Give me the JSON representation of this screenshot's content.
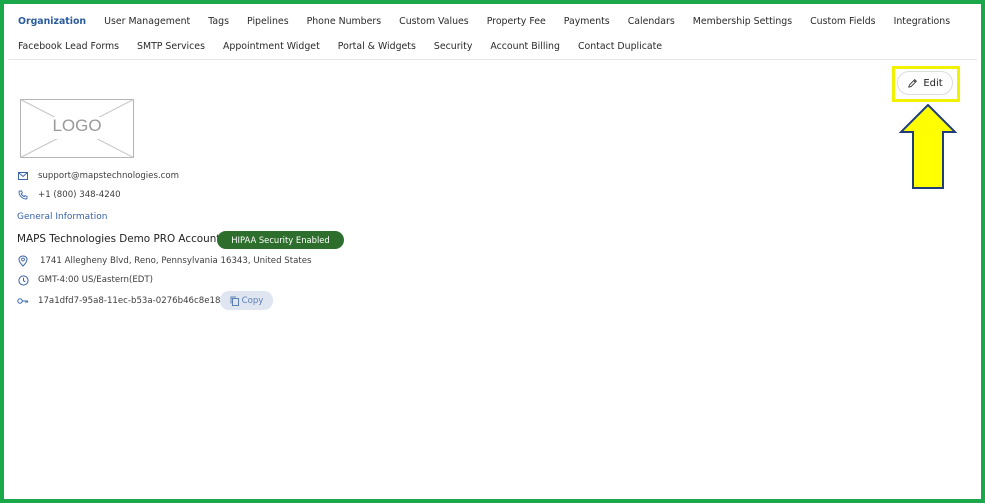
{
  "nav": {
    "row1": [
      "Organization",
      "User Management",
      "Tags",
      "Pipelines",
      "Phone Numbers",
      "Custom Values",
      "Property Fee",
      "Payments",
      "Calendars",
      "Membership Settings",
      "Custom Fields",
      "Integrations"
    ],
    "row2": [
      "Facebook Lead Forms",
      "SMTP Services",
      "Appointment Widget",
      "Portal & Widgets",
      "Security",
      "Account Billing",
      "Contact Duplicate"
    ],
    "active": "Organization"
  },
  "edit": {
    "label": "Edit",
    "icon": "pencil-icon"
  },
  "logo": {
    "text": "LOGO"
  },
  "contact": {
    "email": "support@mapstechnologies.com",
    "phone": "+1 (800) 348-4240"
  },
  "general": {
    "title": "General Information",
    "account_name": "MAPS Technologies Demo PRO Account",
    "badge": "HIPAA Security Enabled",
    "address": "1741 Allegheny Blvd, Reno, Pennsylvania 16343, United States",
    "timezone": "GMT-4:00 US/Eastern(EDT)",
    "account_id": "17a1dfd7-95a8-11ec-b53a-0276b46c8e18",
    "copy_label": "Copy"
  },
  "colors": {
    "frame": "#1aa84a",
    "highlight": "#f2f200",
    "accent": "#3a64a8",
    "badge": "#2e6e2d"
  }
}
